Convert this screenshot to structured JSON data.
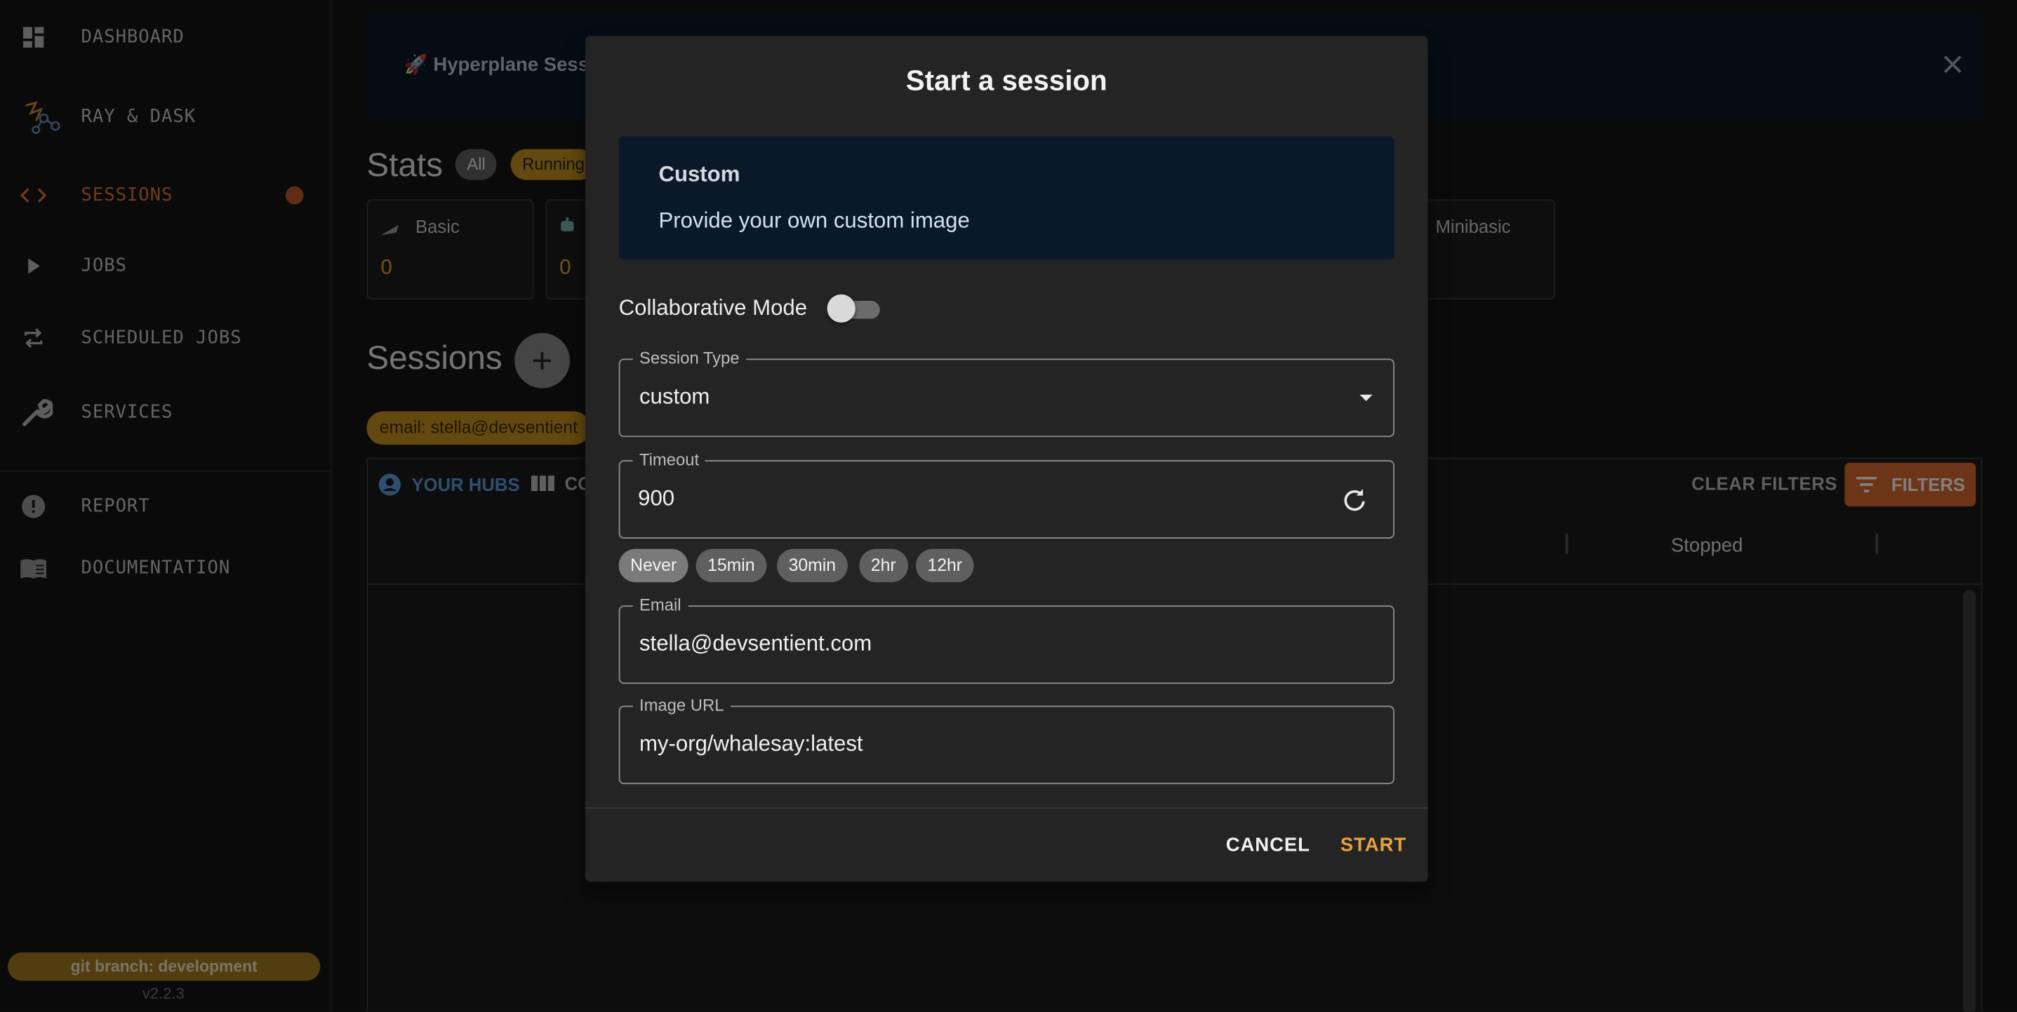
{
  "sidebar": {
    "items": [
      {
        "label": "DASHBOARD",
        "icon": "dashboard-icon"
      },
      {
        "label": "RAY & DASK",
        "icon": "ray-dask-icon"
      },
      {
        "label": "SESSIONS",
        "icon": "code-icon",
        "active": true
      },
      {
        "label": "JOBS",
        "icon": "play-icon"
      },
      {
        "label": "SCHEDULED JOBS",
        "icon": "repeat-icon"
      },
      {
        "label": "SERVICES",
        "icon": "wrench-icon"
      },
      {
        "label": "REPORT",
        "icon": "alert-icon"
      },
      {
        "label": "DOCUMENTATION",
        "icon": "book-icon"
      }
    ],
    "git_branch": "git branch: development",
    "version": "v2.2.3"
  },
  "banner": {
    "text": "🚀 Hyperplane Sess"
  },
  "stats": {
    "title": "Stats",
    "filter_all": "All",
    "filter_running": "Running",
    "cards": [
      {
        "label": "Basic",
        "value": "0"
      },
      {
        "label": "",
        "value": "0"
      },
      {
        "label": "Minibasic",
        "value": ""
      }
    ]
  },
  "sessions": {
    "title": "Sessions",
    "add_label": "+",
    "email_filter": "email: stella@devsentient",
    "tab_hubs": "YOUR HUBS",
    "tab_co": "CO",
    "clear_filters": "CLEAR FILTERS",
    "filters": "FILTERS",
    "column_stopped": "Stopped"
  },
  "dialog": {
    "title": "Start a session",
    "custom_card": {
      "title": "Custom",
      "description": "Provide your own custom image"
    },
    "collaborative_mode": {
      "label": "Collaborative Mode",
      "enabled": false
    },
    "session_type": {
      "label": "Session Type",
      "value": "custom"
    },
    "timeout": {
      "label": "Timeout",
      "value": "900"
    },
    "timeout_presets": [
      "Never",
      "15min",
      "30min",
      "2hr",
      "12hr"
    ],
    "email": {
      "label": "Email",
      "value": "stella@devsentient.com"
    },
    "image_url": {
      "label": "Image URL",
      "value": "my-org/whalesay:latest"
    },
    "cancel_label": "CANCEL",
    "start_label": "START"
  },
  "colors": {
    "accent_orange": "#e0743e",
    "accent_gold": "#e6a23c",
    "banner_bg": "#0a1929",
    "link_blue": "#5e9ee0"
  }
}
